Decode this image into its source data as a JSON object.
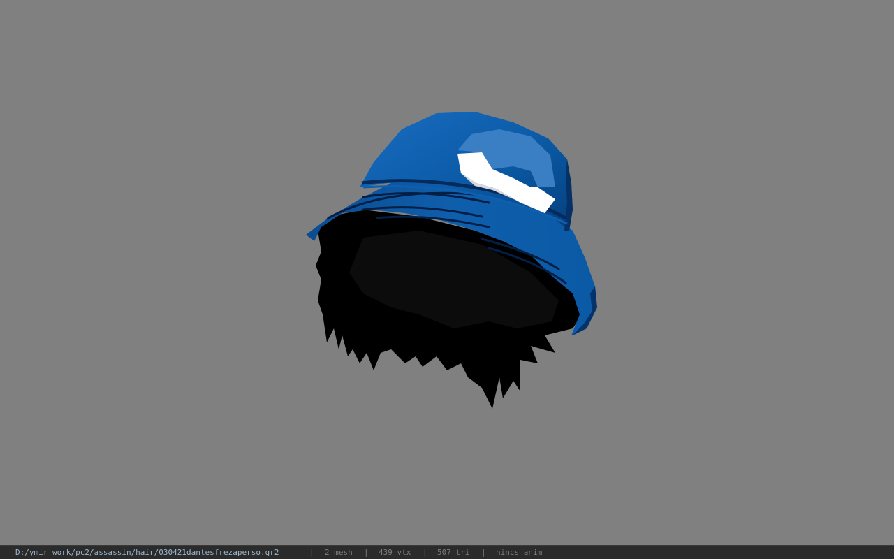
{
  "viewer": {
    "background_color": "#808080",
    "model": {
      "hat_color": "#0a5aa6",
      "hair_color": "#000000",
      "logo_color": "#ffffff"
    }
  },
  "status_bar": {
    "file_path": "D:/ymir work/pc2/assassin/hair/030421dantesfrezaperso.gr2",
    "separator": "|",
    "mesh_count": "2 mesh",
    "vertex_count": "439 vtx",
    "triangle_count": "507 tri",
    "anim_status": "nincs anim"
  }
}
